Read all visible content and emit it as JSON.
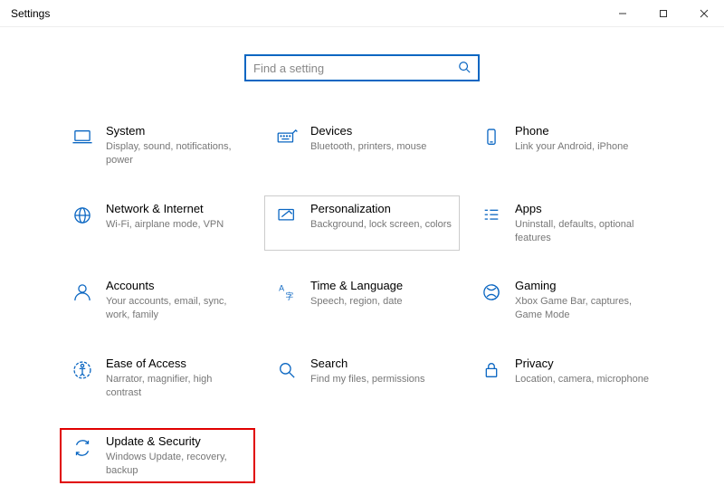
{
  "window": {
    "title": "Settings"
  },
  "search": {
    "placeholder": "Find a setting"
  },
  "tiles": {
    "system": {
      "name": "System",
      "desc": "Display, sound, notifications, power"
    },
    "devices": {
      "name": "Devices",
      "desc": "Bluetooth, printers, mouse"
    },
    "phone": {
      "name": "Phone",
      "desc": "Link your Android, iPhone"
    },
    "network": {
      "name": "Network & Internet",
      "desc": "Wi-Fi, airplane mode, VPN"
    },
    "personalization": {
      "name": "Personalization",
      "desc": "Background, lock screen, colors"
    },
    "apps": {
      "name": "Apps",
      "desc": "Uninstall, defaults, optional features"
    },
    "accounts": {
      "name": "Accounts",
      "desc": "Your accounts, email, sync, work, family"
    },
    "time": {
      "name": "Time & Language",
      "desc": "Speech, region, date"
    },
    "gaming": {
      "name": "Gaming",
      "desc": "Xbox Game Bar, captures, Game Mode"
    },
    "ease": {
      "name": "Ease of Access",
      "desc": "Narrator, magnifier, high contrast"
    },
    "search_tile": {
      "name": "Search",
      "desc": "Find my files, permissions"
    },
    "privacy": {
      "name": "Privacy",
      "desc": "Location, camera, microphone"
    },
    "update": {
      "name": "Update & Security",
      "desc": "Windows Update, recovery, backup"
    }
  }
}
